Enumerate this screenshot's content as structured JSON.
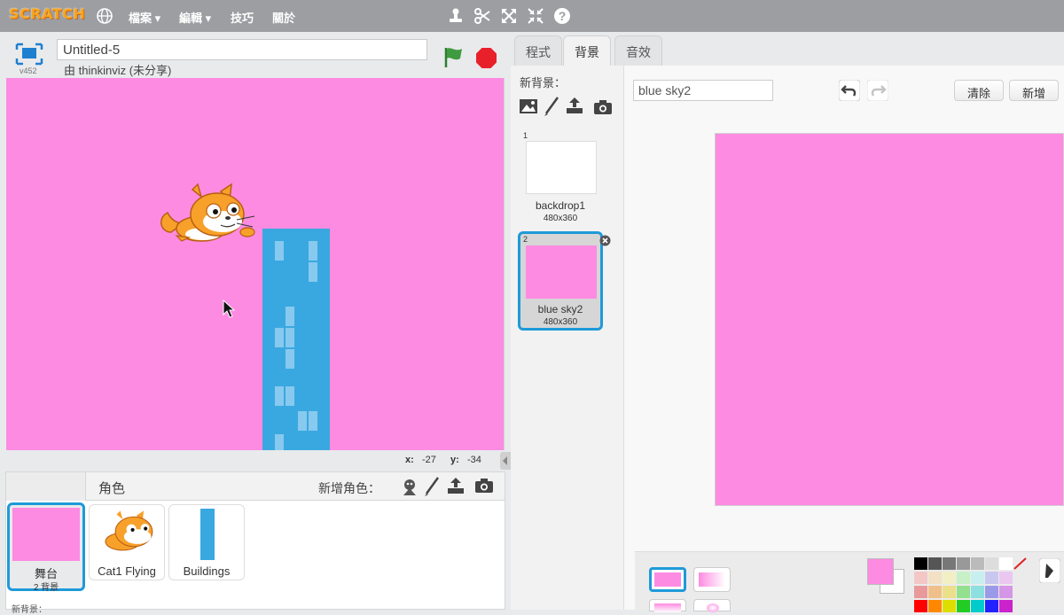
{
  "menubar": {
    "logo": "SCRATCH",
    "items": [
      "檔案 ▾",
      "編輯 ▾",
      "技巧",
      "關於"
    ],
    "tool_icons": [
      "stamp-icon",
      "cut-icon",
      "grow-icon",
      "shrink-icon",
      "help-icon"
    ]
  },
  "project": {
    "title": "Untitled-5",
    "owner": "由 thinkinviz (未分享)",
    "version": "v452"
  },
  "stage": {
    "background_color": "#fd8be2",
    "mouse_x_label": "x:",
    "mouse_x": "-27",
    "mouse_y_label": "y:",
    "mouse_y": "-34"
  },
  "sprites": {
    "header": "角色",
    "new_sprite_label": "新增角色：",
    "stage_thumb": {
      "label": "舞台",
      "sub": "2 背景"
    },
    "items": [
      {
        "name": "Cat1 Flying"
      },
      {
        "name": "Buildings"
      }
    ],
    "new_backdrop_label": "新背景："
  },
  "tabs": [
    "程式",
    "背景",
    "音效"
  ],
  "backdrops": {
    "new_backdrop_label": "新背景：",
    "items": [
      {
        "index": "1",
        "name": "backdrop1",
        "size": "480x360"
      },
      {
        "index": "2",
        "name": "blue sky2",
        "size": "480x360"
      }
    ]
  },
  "editor": {
    "costume_name": "blue sky2",
    "clear_label": "清除",
    "add_label": "新增",
    "fill_color": "#fd8be2",
    "palette": [
      "#000000",
      "#555555",
      "#777777",
      "#999999",
      "#bbbbbb",
      "#dddddd",
      "#ffffff",
      "#f4c7c7",
      "#f3e1c5",
      "#f3efc5",
      "#c7f0c7",
      "#c7eff0",
      "#c7c7f0",
      "#e9c7f0",
      "#e89a9a",
      "#f0c08a",
      "#ecdf8a",
      "#93e08f",
      "#8ddfe0",
      "#9a9ae8",
      "#d696e8",
      "#ff0000",
      "#ff8800",
      "#dddd00",
      "#22cc22",
      "#00cccc",
      "#2222ff",
      "#cc22cc"
    ]
  }
}
